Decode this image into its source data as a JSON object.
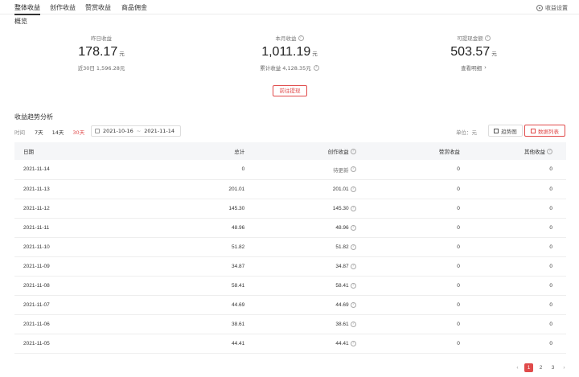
{
  "tabs": [
    {
      "label": "整体收益",
      "active": true
    },
    {
      "label": "创作收益",
      "active": false
    },
    {
      "label": "赞赏收益",
      "active": false
    },
    {
      "label": "商品佣金",
      "active": false
    }
  ],
  "settings_label": "收益设置",
  "overview": {
    "title": "概览",
    "yesterday": {
      "label": "昨日收益",
      "value": "178.17",
      "unit": "元",
      "sub": "近30日 1,596.28元"
    },
    "month": {
      "label": "本月收益",
      "value": "1,011.19",
      "unit": "元",
      "sub": "累计收益 4,128.35元"
    },
    "withdrawable": {
      "label": "可提现金额",
      "value": "503.57",
      "unit": "元",
      "sub": "查看明细"
    },
    "withdraw_button": "前往提现"
  },
  "trend": {
    "title": "收益趋势分析",
    "time_label": "时间",
    "options": [
      {
        "label": "7天",
        "active": false
      },
      {
        "label": "14天",
        "active": false
      },
      {
        "label": "30天",
        "active": true
      }
    ],
    "date_start": "2021-10-16",
    "date_sep": "~",
    "date_end": "2021-11-14",
    "unit_label": "单位：元",
    "chart_view_label": "趋势图",
    "list_view_label": "数据列表"
  },
  "table": {
    "headers": [
      "日期",
      "总计",
      "创作收益",
      "赞赏收益",
      "其他收益"
    ],
    "rows": [
      [
        "2021-11-14",
        "0",
        "待更新",
        "0",
        "0"
      ],
      [
        "2021-11-13",
        "201.01",
        "201.01",
        "0",
        "0"
      ],
      [
        "2021-11-12",
        "145.30",
        "145.30",
        "0",
        "0"
      ],
      [
        "2021-11-11",
        "48.96",
        "48.96",
        "0",
        "0"
      ],
      [
        "2021-11-10",
        "51.82",
        "51.82",
        "0",
        "0"
      ],
      [
        "2021-11-09",
        "34.87",
        "34.87",
        "0",
        "0"
      ],
      [
        "2021-11-08",
        "58.41",
        "58.41",
        "0",
        "0"
      ],
      [
        "2021-11-07",
        "44.69",
        "44.69",
        "0",
        "0"
      ],
      [
        "2021-11-06",
        "38.61",
        "38.61",
        "0",
        "0"
      ],
      [
        "2021-11-05",
        "44.41",
        "44.41",
        "0",
        "0"
      ]
    ]
  },
  "pagination": {
    "prev": "‹",
    "pages": [
      "1",
      "2",
      "3"
    ],
    "current": "1",
    "next": "›"
  },
  "colors": {
    "accent": "#e04a4a",
    "header_bg": "#f5f6f8"
  }
}
